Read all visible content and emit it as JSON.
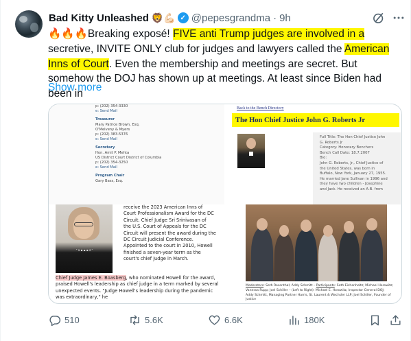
{
  "tweet": {
    "display_name": "Bad Kitty Unleashed",
    "name_emoji": "🦁💪🏻",
    "handle": "@pepesgrandma",
    "separator": "·",
    "time": "9h",
    "text_prefix": "🔥🔥🔥Breaking exposé! ",
    "text_hl1": "FIVE anti Trump judges are involved in a",
    "text_mid1": "secretive, INVITE ONLY club for judges and lawyers called the ",
    "text_hl2": "American Inns of Court",
    "text_rest": ". Even the membership and meetings are secret. But somehow the DOJ has shown up at meetings. At least since Biden had been in",
    "show_more": "Show more"
  },
  "media": {
    "left_doc": {
      "lines_top": [
        "p: (202) 354-3330",
        "e: Send Mail"
      ],
      "treasurer_heading": "Treasurer",
      "treasurer_lines": [
        "Mary Patrice Brown, Esq.",
        "O'Melveny & Myers",
        "p: (202) 383-5376",
        "e: Send Mail"
      ],
      "secretary_heading": "Secretary",
      "secretary_lines": [
        "Hon. Amit P. Mehta",
        "US District Court District of Columbia",
        "p: (202) 354-3250",
        "e: Send Mail"
      ],
      "program_heading": "Program Chair",
      "program_lines": [
        "Gary Bass, Esq."
      ]
    },
    "right_doc": {
      "back_link": "Back to the Bench Directory",
      "title": "The Hon Chief Justice John G. Roberts Jr",
      "info_lines": [
        "Full Title: The Hon Chief Justice John",
        "G. Roberts Jr",
        "Category: Honorary Benchers",
        "Bench Call Date: 18.7.2007",
        "Bio:",
        "John G. Roberts, Jr., Chief Justice of",
        "the United States, was born in",
        "Buffalo, New York, January 27, 1955.",
        "He married Jane Sullivan in 1996 and",
        "they have two children - Josephine",
        "and Jack. He received an A.B. from"
      ]
    },
    "article": {
      "column_lines": [
        "receive the 2023 American Inns of",
        "Court Professionalism Award for the DC",
        "Circuit. Chief Judge Sri Srinivasan of",
        "the U.S. Court of Appeals for the DC",
        "Circuit will present the award during the",
        "DC Circuit Judicial Conference.",
        "Appointed to the court in 2010, Howell",
        "finished a seven-year term as the",
        "court's chief judge in March."
      ],
      "caption_highlight": "Chief Judge James E. Boasberg",
      "caption_rest": ", who nominated Howell for the award, praised Howell's leadership as chief judge in a term marked by several unexpected events. \"Judge Howell's leadership during the pandemic was extraordinary,\" he"
    },
    "group_photo_caption": {
      "moderators_label": "Moderators",
      "moderators": ": Seth Rosenthal; Addy Schmitt – ",
      "participants_label": "Participants",
      "participants": ": Seth Eichenholtz; Michael Horowitz; Vanessa Rupp; Joel Schiller – (Left to Right): Michael E. Horowitz, Inspector General DOJ; Addy Schmitt, Managing Partner Harris, St. Laurent & Wechsler LLP; Joel Schiller, Founder of Justice"
    }
  },
  "actions": {
    "reply_count": "510",
    "retweet_count": "5.6K",
    "like_count": "6.6K",
    "view_count": "180K"
  },
  "colors": {
    "accent": "#1d9bf0",
    "highlight": "#fff700",
    "muted": "#536471"
  }
}
